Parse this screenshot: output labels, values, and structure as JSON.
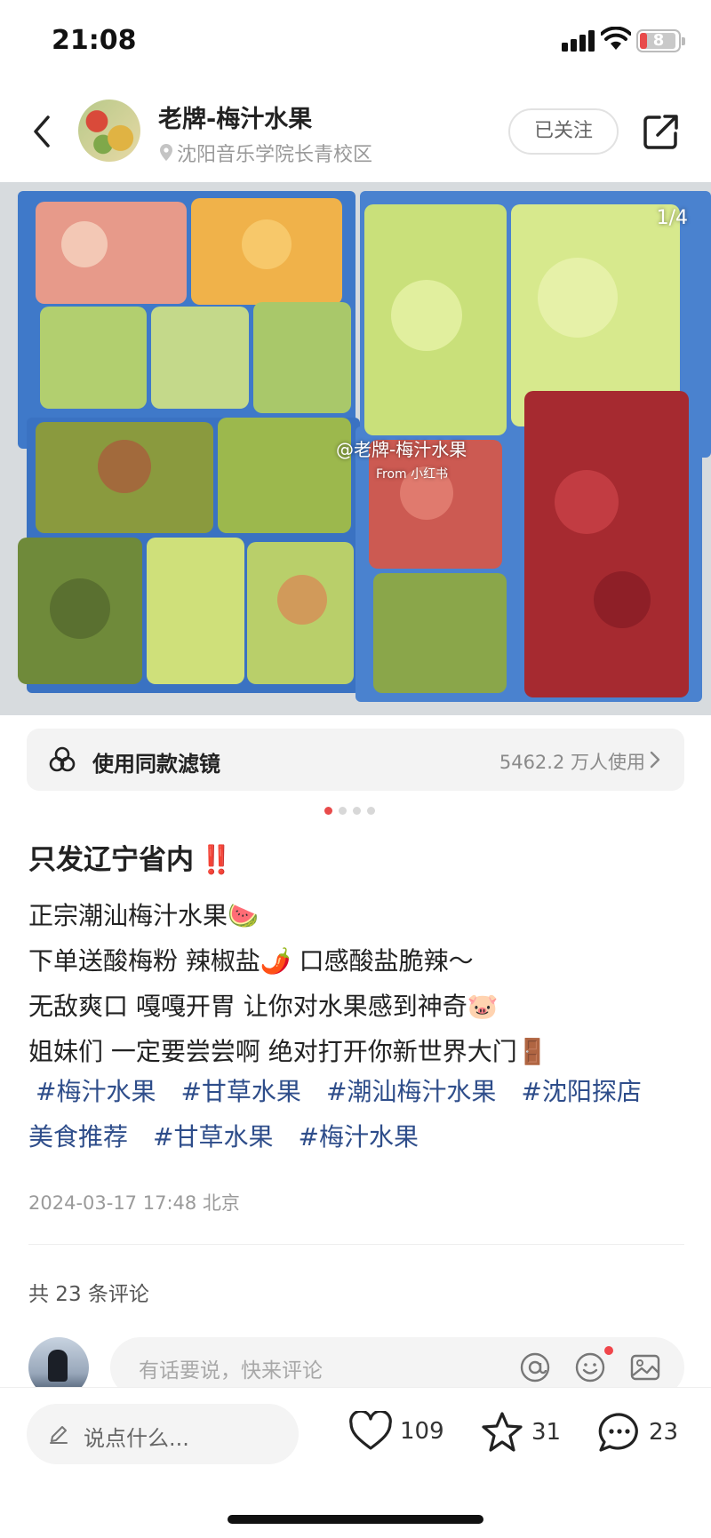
{
  "status_bar": {
    "time": "21:08",
    "battery": "8"
  },
  "header": {
    "title": "老牌-梅汁水果",
    "location": "沈阳音乐学院长青校区",
    "follow_label": "已关注"
  },
  "photo": {
    "counter": "1/4",
    "watermark_handle": "@老牌-梅汁水果",
    "watermark_source": "From 小红书"
  },
  "filter": {
    "label": "使用同款滤镜",
    "users": "5462.2 万人使用"
  },
  "carousel": {
    "total": 4,
    "active": 1
  },
  "post": {
    "title": "只发辽宁省内",
    "title_emoji": "‼️",
    "lines": [
      "正宗潮汕梅汁水果🍉",
      "下单送酸梅粉 辣椒盐🌶️ 口感酸盐脆辣～",
      "无敌爽口 嘎嘎开胃 让你对水果感到神奇🐷",
      "姐妹们 一定要尝尝啊 绝对打开你新世界大门🚪"
    ],
    "tags": [
      "#梅汁水果",
      "#甘草水果",
      "#潮汕梅汁水果",
      "#沈阳探店",
      "美食推荐",
      "#甘草水果",
      "#梅汁水果"
    ],
    "date": "2024-03-17 17:48 北京"
  },
  "comments": {
    "count_label": "共 23 条评论",
    "input_placeholder": "有话要说，快来评论"
  },
  "bottom_bar": {
    "say_placeholder": "说点什么...",
    "likes": "109",
    "stars": "31",
    "comments": "23"
  },
  "colors": {
    "accent": "#e84b4b",
    "tag": "#2e4d8a"
  }
}
